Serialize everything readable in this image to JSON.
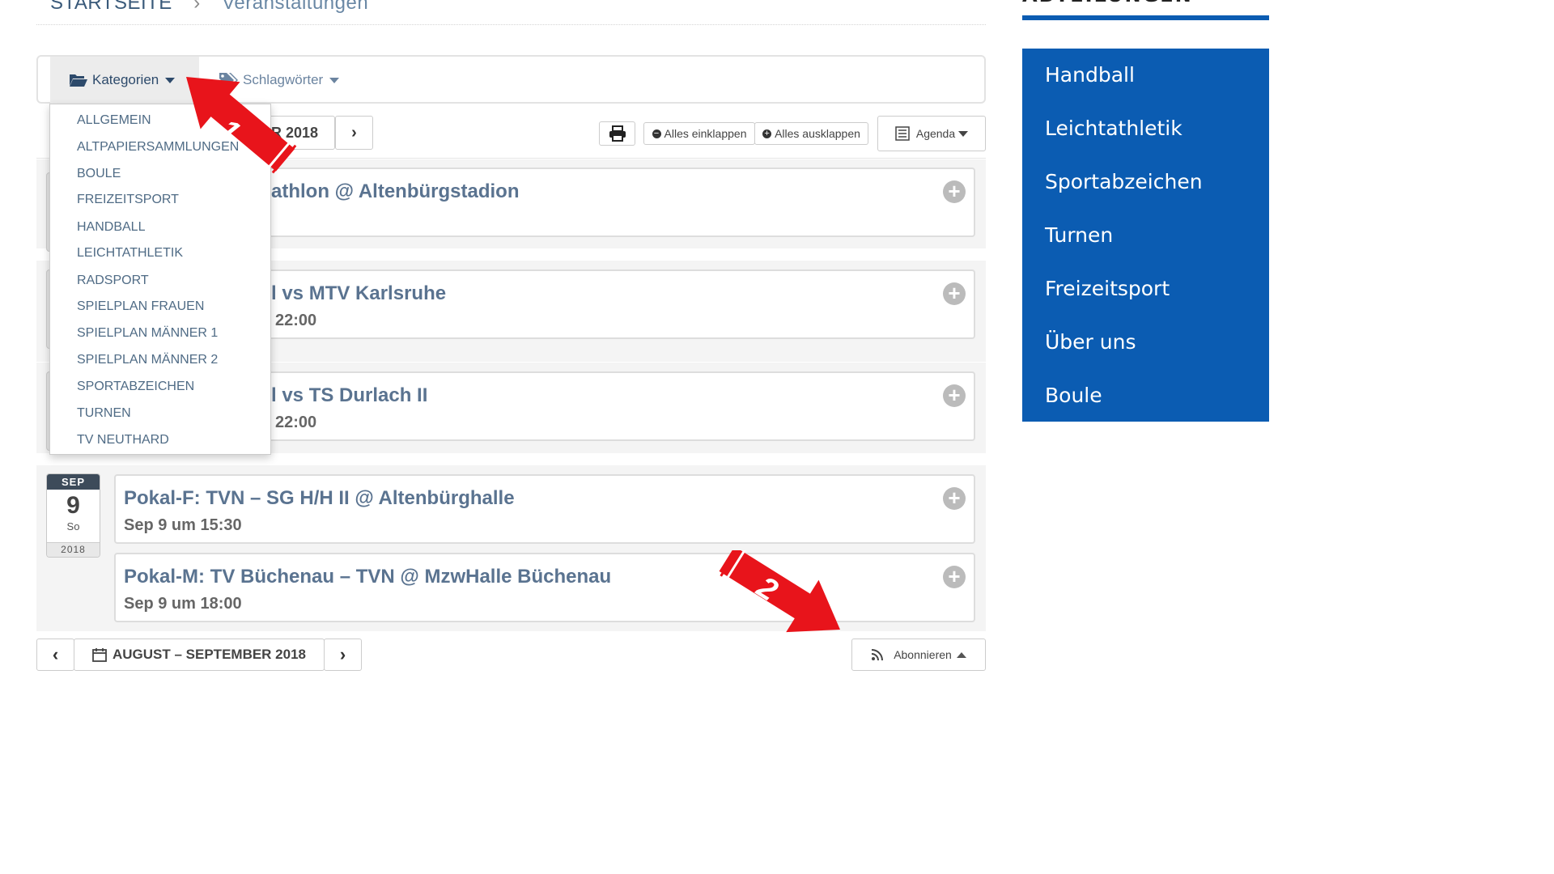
{
  "breadcrumb": {
    "home": "STARTSEITE",
    "separator": "›",
    "current": "Veranstaltungen"
  },
  "sidebar": {
    "heading": "ABTEILUNGEN",
    "items": [
      "Handball",
      "Leichtathletik",
      "Sportabzeichen",
      "Turnen",
      "Freizeitsport",
      "Über uns",
      "Boule"
    ]
  },
  "filters": {
    "categories_label": "Kategorien",
    "tags_label": "Schlagwörter"
  },
  "toolbar": {
    "month_label": "ER 2018",
    "collapse_label": "Alles einklappen",
    "expand_label": "Alles ausklappen",
    "view_label": "Agenda"
  },
  "categories": [
    "Allgemein",
    "Altpapiersammlungen",
    "Boule",
    "Freizeitsport",
    "Handball",
    "Leichtathletik",
    "Radsport",
    "Spielplan Frauen",
    "Spielplan Männer 1",
    "Spielplan Männer 2",
    "Sportabzeichen",
    "Turnen",
    "TV Neuthard"
  ],
  "events": [
    {
      "title": "athlon @ Altenbürgstadion",
      "time": ""
    },
    {
      "title": "l vs MTV Karlsruhe",
      "time": "22:00"
    },
    {
      "title": "l vs TS Durlach II",
      "time": "22:00"
    },
    {
      "title": "Pokal-F: TVN – SG H/H II @ Altenbürghalle",
      "time": "Sep 9 um 15:30"
    },
    {
      "title": "Pokal-M: TV Büchenau – TVN @ MzwHalle Büchenau",
      "time": "Sep 9 um 18:00"
    }
  ],
  "date_badge": {
    "month": "SEP",
    "day": "9",
    "weekday": "So",
    "year": "2018"
  },
  "footer": {
    "range_label": "AUGUST – SEPTEMBER 2018",
    "subscribe_label": "Abonnieren"
  },
  "annotations": {
    "arrow1": "1",
    "arrow2": "2"
  },
  "colors": {
    "sidebar_bg": "#0b5cb2",
    "link": "#4f6b85",
    "arrow": "#e8141b"
  }
}
